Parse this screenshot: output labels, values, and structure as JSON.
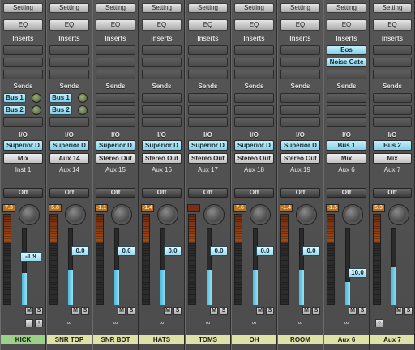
{
  "labels": {
    "setting": "Setting",
    "eq": "EQ",
    "inserts": "Inserts",
    "sends": "Sends",
    "io": "I/O",
    "auto": "Off"
  },
  "strips": [
    {
      "name": "Inst 1",
      "input": "Superior D",
      "output": "Mix",
      "sends": [
        "Bus 1",
        "Bus 2"
      ],
      "peak": "7.3",
      "gain": "-1.9",
      "fader_level": 0.42,
      "group": "KICK",
      "group_color": "#9bd087",
      "footer": "pan",
      "footer_chars": [
        "−",
        "+"
      ]
    },
    {
      "name": "Aux 14",
      "input": "Superior D",
      "output": "Aux 14",
      "sends": [
        "Bus 1",
        "Bus 2"
      ],
      "peak": "5.8",
      "gain": "0.0",
      "fader_level": 0.46,
      "group": "SNR TOP",
      "group_color": "#dfe2a6",
      "footer": "link",
      "footer_chars": [
        "∞"
      ]
    },
    {
      "name": "Aux 15",
      "input": "Superior D",
      "output": "Stereo Out",
      "sends": [],
      "peak": "-1.1",
      "gain": "0.0",
      "fader_level": 0.46,
      "group": "SNR BOT",
      "group_color": "#dfe2a6",
      "footer": "link",
      "footer_chars": [
        "∞"
      ]
    },
    {
      "name": "Aux 16",
      "input": "Superior D",
      "output": "Stereo Out",
      "sends": [],
      "peak": "-1.4",
      "gain": "0.0",
      "fader_level": 0.46,
      "group": "HATS",
      "group_color": "#dfe2a6",
      "footer": "link",
      "footer_chars": [
        "∞"
      ]
    },
    {
      "name": "Aux 17",
      "input": "Superior D",
      "output": "Stereo Out",
      "sends": [],
      "peak": "",
      "gain": "0.0",
      "fader_level": 0.46,
      "group": "TOMS",
      "group_color": "#dfe2a6",
      "footer": "link",
      "footer_chars": [
        "∞"
      ]
    },
    {
      "name": "Aux 18",
      "input": "Superior D",
      "output": "Stereo Out",
      "sends": [],
      "peak": "7.6",
      "gain": "0.0",
      "fader_level": 0.46,
      "group": "OH",
      "group_color": "#dfe2a6",
      "footer": "link",
      "footer_chars": [
        "∞"
      ]
    },
    {
      "name": "Aux 19",
      "input": "Superior D",
      "output": "Stereo Out",
      "sends": [],
      "peak": "-1.4",
      "gain": "0.0",
      "fader_level": 0.46,
      "group": "ROOM",
      "group_color": "#dfe2a6",
      "footer": "link",
      "footer_chars": [
        "∞"
      ]
    },
    {
      "name": "Aux 6",
      "input": "Bus 1",
      "output": "Mix",
      "sends": [],
      "peak": "-1.5",
      "gain": "10.0",
      "fader_level": 0.3,
      "group": "Aux 6",
      "group_color": "#dfe2a6",
      "footer": "link",
      "footer_chars": [
        "∞"
      ],
      "inserts": [
        "Eos",
        "Noise Gate"
      ]
    },
    {
      "name": "Aux 7",
      "input": "Bus 2",
      "output": "Mix",
      "sends": [],
      "peak": "5.3",
      "gain": "",
      "fader_level": 0.5,
      "group": "Aux 7",
      "group_color": "#dfe2a6",
      "footer": "single",
      "footer_chars": [
        "○"
      ]
    }
  ]
}
